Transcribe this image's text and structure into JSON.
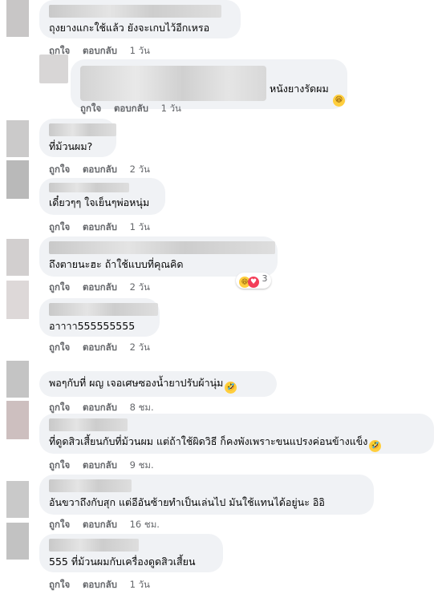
{
  "comments": [
    {
      "text": "ถุงยางแกะใช้แล้ว ยังจะเกบไว้อีกเหรอ",
      "like": "ถูกใจ",
      "reply": "ตอบกลับ",
      "time": "1 วัน"
    },
    {
      "text": "หนังยางรัดผม",
      "emoji": "laughing-emoji",
      "like": "ถูกใจ",
      "reply": "ตอบกลับ",
      "time": "1 วัน"
    },
    {
      "text": "ที่ม้วนผม?",
      "like": "ถูกใจ",
      "reply": "ตอบกลับ",
      "time": "2 วัน"
    },
    {
      "text": "เดี๋ยวๆๆ ใจเย็นๆพ่อหนุ่ม",
      "like": "ถูกใจ",
      "reply": "ตอบกลับ",
      "time": "1 วัน"
    },
    {
      "text": "ถึงตายนะฮะ ถ้าใช้แบบที่คุณคิด",
      "like": "ถูกใจ",
      "reply": "ตอบกลับ",
      "time": "2 วัน",
      "reaction_count": "3"
    },
    {
      "text": "อาาาา555555555",
      "like": "ถูกใจ",
      "reply": "ตอบกลับ",
      "time": "2 วัน"
    },
    {
      "text": "พอๆกับที่ ผญ เจอเศษซองน้ำยาปรับผ้านุ่ม",
      "emoji": "rofl-emoji",
      "like": "ถูกใจ",
      "reply": "ตอบกลับ",
      "time": "8 ชม."
    },
    {
      "text": "ที่ดูดสิวเสี้ยนกับที่ม้วนผม แต่ถ้าใช้ผิดวิธี ก็คงพังเพราะขนแปรงค่อนข้างแข็ง",
      "emoji": "rofl-emoji",
      "like": "ถูกใจ",
      "reply": "ตอบกลับ",
      "time": "9 ชม."
    },
    {
      "text": "อันขวาถึงกับสุก แต่อีอันซ้ายทำเป็นเล่นไป มันใช้แทนได้อยู่นะ อิอิ",
      "like": "ถูกใจ",
      "reply": "ตอบกลับ",
      "time": "16 ชม."
    },
    {
      "text": "555 ที่ม้วนผมกับเครื่องดูดสิวเสี้ยน",
      "like": "ถูกใจ",
      "reply": "ตอบกลับ",
      "time": "1 วัน"
    }
  ],
  "colors": {
    "bubble": "#f0f2f5",
    "meta": "#65676b",
    "text": "#050505"
  }
}
